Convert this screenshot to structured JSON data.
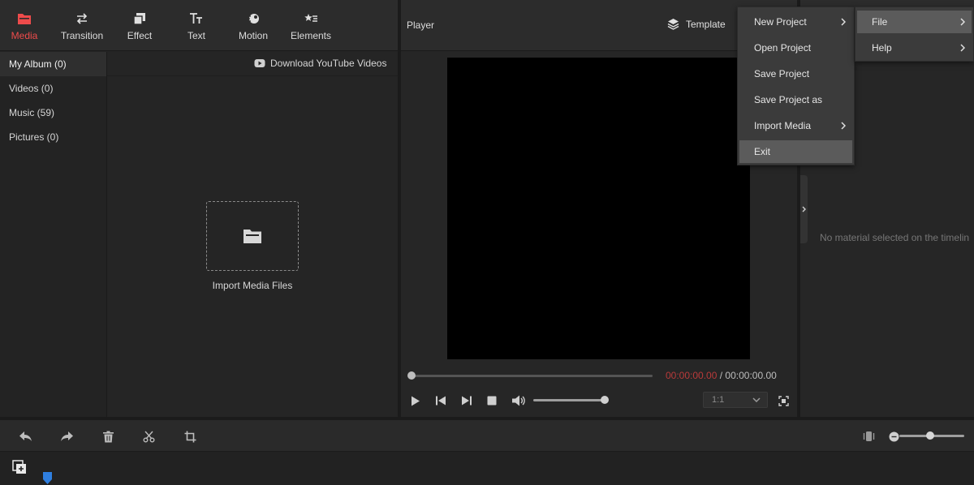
{
  "toolbar": {
    "items": [
      {
        "label": "Media",
        "icon": "folder-icon",
        "active": true
      },
      {
        "label": "Transition",
        "icon": "swap-arrows-icon"
      },
      {
        "label": "Effect",
        "icon": "effect-layers-icon"
      },
      {
        "label": "Text",
        "icon": "text-icon"
      },
      {
        "label": "Motion",
        "icon": "motion-ball-icon"
      },
      {
        "label": "Elements",
        "icon": "elements-star-icon"
      }
    ],
    "active_color": "#ee4b4b"
  },
  "album": {
    "items": [
      "My Album (0)",
      "Videos (0)",
      "Music (59)",
      "Pictures (0)"
    ],
    "selected": "My Album (0)"
  },
  "media": {
    "download_label": "Download YouTube Videos",
    "import_label": "Import Media Files"
  },
  "player": {
    "title": "Player",
    "template_label": "Template",
    "time_current": "00:00:00.00",
    "time_separator": " / ",
    "time_total": "00:00:00.00",
    "seek_progress": 0,
    "volume_level": 0.95,
    "ratio": "1:1",
    "time_current_color": "#b83a3a"
  },
  "properties": {
    "empty_message": "No material selected on the timelin"
  },
  "timeline": {
    "zoom_level": 0.45
  },
  "menu": {
    "main": [
      {
        "label": "File",
        "has_submenu": true,
        "highlighted": true
      },
      {
        "label": "Help",
        "has_submenu": true
      }
    ],
    "file_submenu": [
      {
        "label": "New Project",
        "has_submenu": true
      },
      {
        "label": "Open Project"
      },
      {
        "label": "Save Project"
      },
      {
        "label": "Save Project as"
      },
      {
        "label": "Import Media",
        "has_submenu": true
      },
      {
        "label": "Exit",
        "highlighted": true
      }
    ]
  }
}
